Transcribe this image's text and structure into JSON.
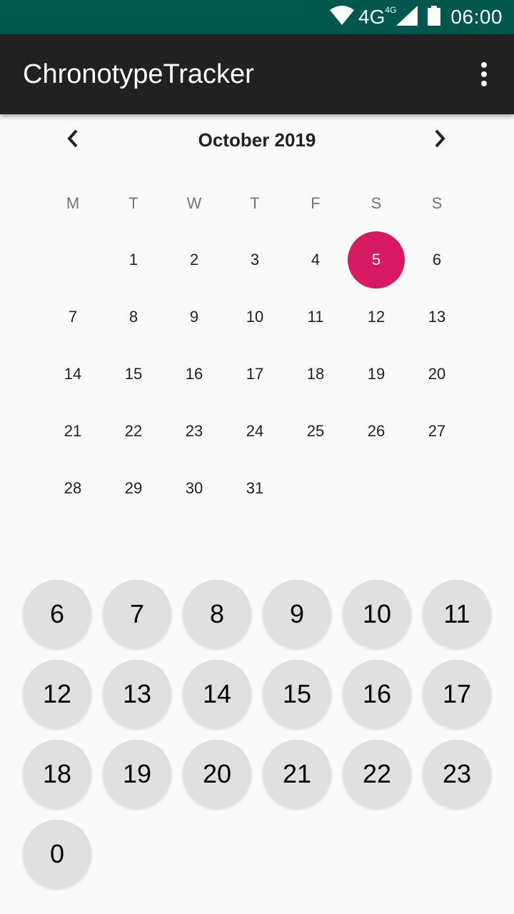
{
  "status_bar": {
    "network": "4G",
    "network_small": "4G",
    "time": "06:00",
    "icons": [
      "wifi-icon",
      "signal-icon",
      "battery-icon"
    ]
  },
  "app_bar": {
    "title": "ChronotypeTracker",
    "overflow_icon": "more-vert-icon"
  },
  "calendar": {
    "month_title": "October 2019",
    "weekdays": [
      "M",
      "T",
      "W",
      "T",
      "F",
      "S",
      "S"
    ],
    "first_day_offset": 1,
    "days_in_month": 31,
    "selected_day": 5,
    "selected_color": "#d81b60"
  },
  "hours": [
    "6",
    "7",
    "8",
    "9",
    "10",
    "11",
    "12",
    "13",
    "14",
    "15",
    "16",
    "17",
    "18",
    "19",
    "20",
    "21",
    "22",
    "23",
    "0"
  ],
  "colors": {
    "status_bar": "#00574b",
    "app_bar": "#212121",
    "background": "#fafafa",
    "hour_button": "#e0e0e0"
  }
}
